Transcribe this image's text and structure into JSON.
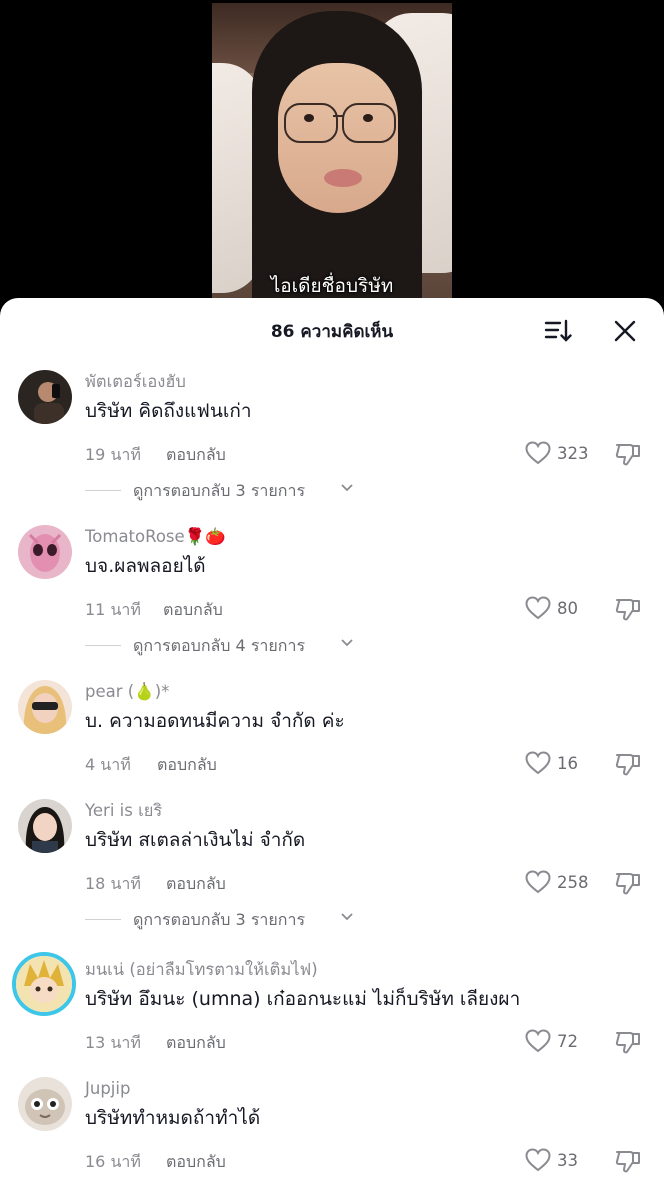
{
  "video": {
    "subtitle": "ไอเดียชื่อบริษัท"
  },
  "header": {
    "title": "86 ความคิดเห็น",
    "sort_icon": "sort-icon",
    "close_icon": "close-icon"
  },
  "colors": {
    "text": "#161823",
    "muted": "#8a8b91",
    "ring": "#3ec6e8"
  },
  "comments": [
    {
      "username": "พัตเตอร์เองฮับ",
      "text": "บริษัท คิดถึงแฟนเก่า",
      "time": "19 นาที",
      "reply": "ตอบกลับ",
      "likes": "323",
      "view_replies": "ดูการตอบกลับ 3 รายการ"
    },
    {
      "username": "TomatoRose🌹🍅",
      "text": "บจ.ผลพลอยได้",
      "time": "11 นาที",
      "reply": "ตอบกลับ",
      "likes": "80",
      "view_replies": "ดูการตอบกลับ 4 รายการ"
    },
    {
      "username": "pear (🍐)*",
      "text": "บ. ความอดทนมีความ จำกัด ค่ะ",
      "time": "4 นาที",
      "reply": "ตอบกลับ",
      "likes": "16"
    },
    {
      "username": "Yeri is เยริ",
      "text": "บริษัท สเตลล่าเงินไม่ จำกัด",
      "time": "18 นาที",
      "reply": "ตอบกลับ",
      "likes": "258",
      "view_replies": "ดูการตอบกลับ 3 รายการ"
    },
    {
      "username": "มนเน่ (อย่าลืมโทรตามให้เติมไฟ)",
      "text": "บริษัท อึมนะ (umna) เก๋ออกนะแม่ ไม่ก็บริษัท เลียงผา",
      "time": "13 นาที",
      "reply": "ตอบกลับ",
      "likes": "72"
    },
    {
      "username": "Jupjip",
      "text": "บริษัททำหมดถ้าทำได้",
      "time": "16 นาที",
      "reply": "ตอบกลับ",
      "likes": "33"
    }
  ]
}
